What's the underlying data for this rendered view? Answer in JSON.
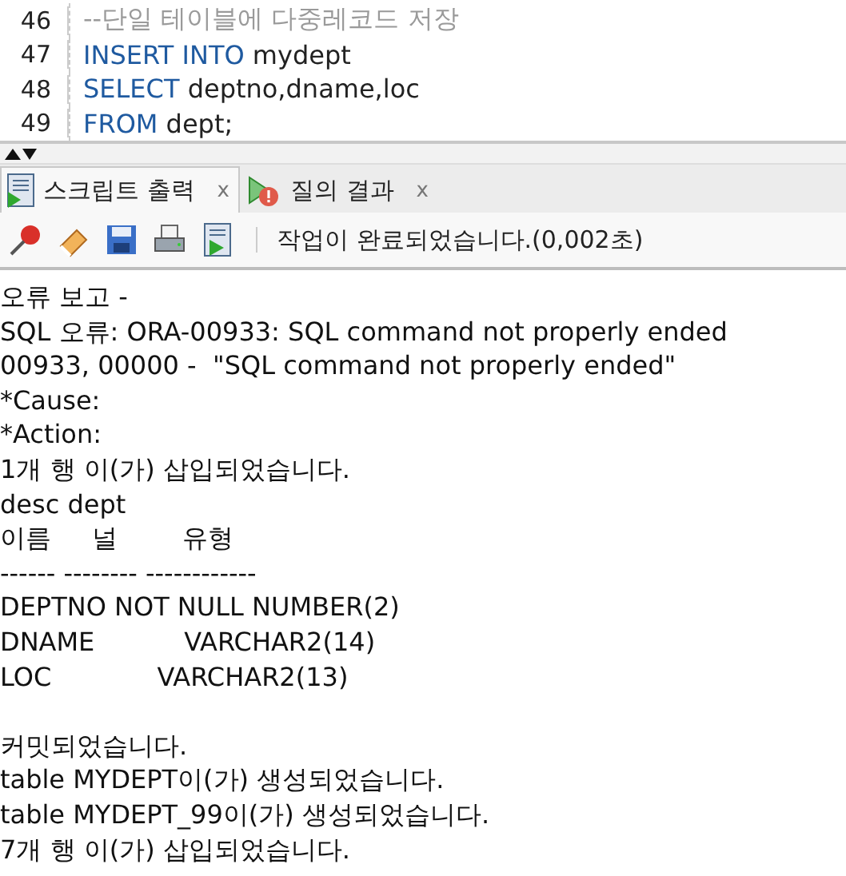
{
  "editor": {
    "lines": [
      {
        "number": "46",
        "tokens": [
          {
            "kind": "comment",
            "text": "--단일 테이블에 다중레코드 저장"
          }
        ]
      },
      {
        "number": "47",
        "tokens": [
          {
            "kind": "keyword",
            "text": "INSERT INTO"
          },
          {
            "kind": "plain",
            "text": " mydept"
          }
        ]
      },
      {
        "number": "48",
        "tokens": [
          {
            "kind": "keyword",
            "text": "SELECT"
          },
          {
            "kind": "plain",
            "text": " deptno,dname,loc"
          }
        ]
      },
      {
        "number": "49",
        "tokens": [
          {
            "kind": "keyword",
            "text": "FROM"
          },
          {
            "kind": "plain",
            "text": " dept;"
          }
        ]
      }
    ]
  },
  "tabs": [
    {
      "label": "스크립트 출력",
      "close": "x",
      "kind": "script",
      "selected": true
    },
    {
      "label": "질의 결과",
      "close": "x",
      "kind": "query",
      "selected": false
    }
  ],
  "toolbar": {
    "status": "작업이 완료되었습니다.(0,002초)"
  },
  "output_blocks": [
    [
      "오류 보고 -",
      "SQL 오류: ORA-00933: SQL command not properly ended",
      "00933, 00000 -  \"SQL command not properly ended\"",
      "*Cause:",
      "*Action:",
      "1개 행 이(가) 삽입되었습니다.",
      "desc dept",
      "이름     널        유형",
      "------ -------- ------------",
      "DEPTNO NOT NULL NUMBER(2)",
      "DNAME           VARCHAR2(14)",
      "LOC             VARCHAR2(13)"
    ],
    [
      "커밋되었습니다.",
      "table MYDEPT이(가) 생성되었습니다.",
      "table MYDEPT_99이(가) 생성되었습니다.",
      "7개 행 이(가) 삽입되었습니다."
    ]
  ]
}
